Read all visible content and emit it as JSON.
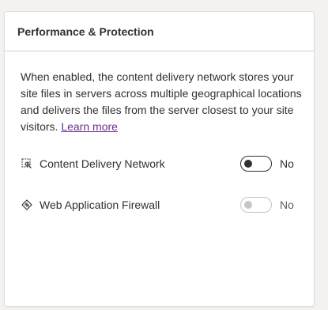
{
  "section": {
    "title": "Performance & Protection",
    "description": "When enabled, the content delivery network stores your site files in servers across multiple geographical locations and delivers the files from the server closest to your site visitors.",
    "learn_more": "Learn more"
  },
  "settings": [
    {
      "label": "Content Delivery Network",
      "icon": "cdn-icon",
      "state": "No",
      "enabled": false,
      "disabled": false
    },
    {
      "label": "Web Application Firewall",
      "icon": "firewall-icon",
      "state": "No",
      "enabled": false,
      "disabled": true
    }
  ],
  "colors": {
    "link": "#6b2c91",
    "text": "#323130",
    "disabled": "#c8c6c4"
  }
}
